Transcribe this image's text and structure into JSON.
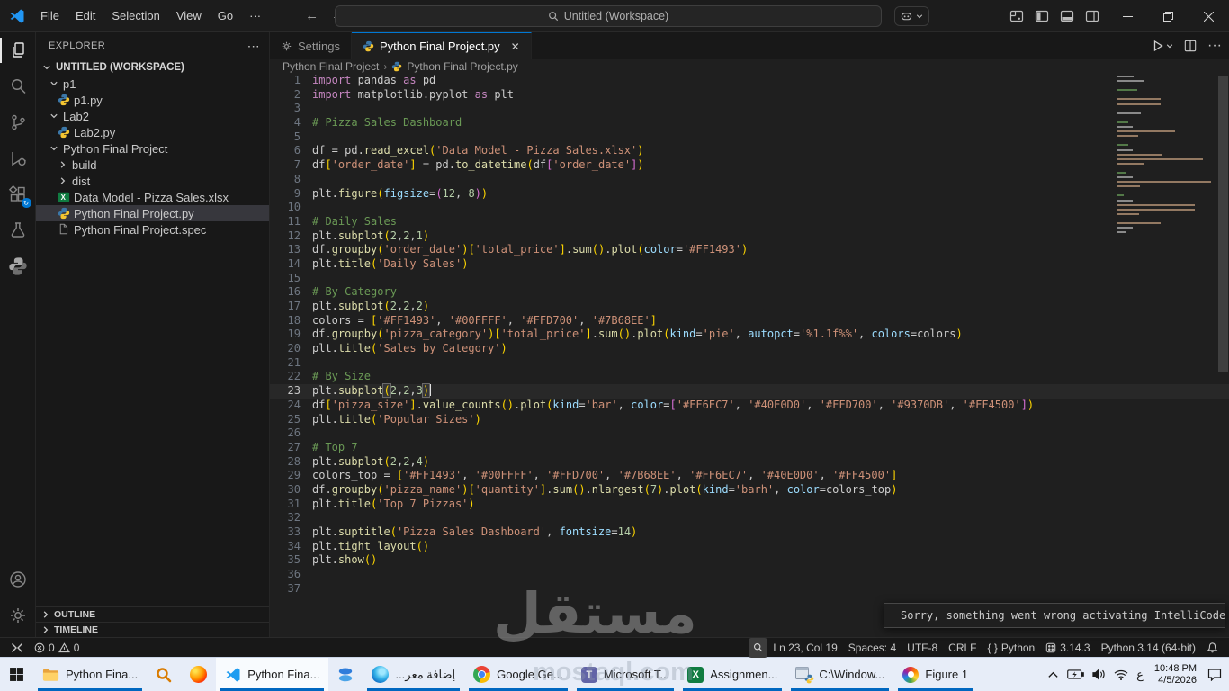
{
  "titlebar": {
    "menus": [
      "File",
      "Edit",
      "Selection",
      "View",
      "Go"
    ],
    "more_label": "···",
    "back": "←",
    "forward": "→",
    "search_text": "Untitled (Workspace)"
  },
  "tabs": {
    "settings": "Settings",
    "main": "Python Final Project.py",
    "close": "✕",
    "more_actions": "···"
  },
  "breadcrumbs": {
    "folder": "Python Final Project",
    "sep": "›",
    "file": "Python Final Project.py"
  },
  "sidebar": {
    "title": "EXPLORER",
    "more": "⋯",
    "tree": [
      {
        "label": "UNTITLED (WORKSPACE)"
      },
      {
        "label": "p1"
      },
      {
        "label": "p1.py"
      },
      {
        "label": "Lab2"
      },
      {
        "label": "Lab2.py"
      },
      {
        "label": "Python Final Project"
      },
      {
        "label": "build"
      },
      {
        "label": "dist"
      },
      {
        "label": "Data Model - Pizza Sales.xlsx"
      },
      {
        "label": "Python Final Project.py"
      },
      {
        "label": "Python Final Project.spec"
      }
    ],
    "panels": {
      "outline": "OUTLINE",
      "timeline": "TIMELINE"
    }
  },
  "editor": {
    "active_line": 23,
    "cursor_col": 19,
    "lines": [
      "import pandas as pd",
      "import matplotlib.pyplot as plt",
      "",
      "# Pizza Sales Dashboard",
      "",
      "df = pd.read_excel('Data Model - Pizza Sales.xlsx')",
      "df['order_date'] = pd.to_datetime(df['order_date'])",
      "",
      "plt.figure(figsize=(12, 8))",
      "",
      "# Daily Sales",
      "plt.subplot(2,2,1)",
      "df.groupby('order_date')['total_price'].sum().plot(color='#FF1493')",
      "plt.title('Daily Sales')",
      "",
      "# By Category",
      "plt.subplot(2,2,2)",
      "colors = ['#FF1493', '#00FFFF', '#FFD700', '#7B68EE']",
      "df.groupby('pizza_category')['total_price'].sum().plot(kind='pie', autopct='%1.1f%%', colors=colors)",
      "plt.title('Sales by Category')",
      "",
      "# By Size",
      "plt.subplot(2,2,3)",
      "df['pizza_size'].value_counts().plot(kind='bar', color=['#FF6EC7', '#40E0D0', '#FFD700', '#9370DB', '#FF4500'])",
      "plt.title('Popular Sizes')",
      "",
      "# Top 7",
      "plt.subplot(2,2,4)",
      "colors_top = ['#FF1493', '#00FFFF', '#FFD700', '#7B68EE', '#FF6EC7', '#40E0D0', '#FF4500']",
      "df.groupby('pizza_name')['quantity'].sum().nlargest(7).plot(kind='barh', color=colors_top)",
      "plt.title('Top 7 Pizzas')",
      "",
      "plt.suptitle('Pizza Sales Dashboard', fontsize=14)",
      "plt.tight_layout()",
      "plt.show()",
      "",
      ""
    ]
  },
  "notification": {
    "message": "Sorry, something went wrong activating IntelliCode support for Pytho..."
  },
  "status_bar": {
    "errors": "0",
    "warnings": "0",
    "line_col": "Ln 23, Col 19",
    "spaces": "Spaces: 4",
    "encoding": "UTF-8",
    "eol": "CRLF",
    "braces": "{ }",
    "language": "Python",
    "version": "3.14.3",
    "interpreter": "Python 3.14 (64-bit)"
  },
  "watermark": {
    "text": "مستقل",
    "domain": "mostaql.com"
  },
  "taskbar": {
    "labels": {
      "explorer": "Python Fina...",
      "vscode": "Python Fina...",
      "edge": "إضافة معر...",
      "chrome": "Google Ge...",
      "teams": "Microsoft T...",
      "excel": "Assignmen...",
      "python_console": "C:\\Window...",
      "figure": "Figure 1"
    },
    "teams_letter": "T",
    "excel_letter": "X",
    "tray": {
      "lang": "ع",
      "time": "10:48 PM",
      "date": "4/5/2026"
    }
  },
  "colors": {
    "accent": "#0078d4",
    "taskbar_underline": "#0067c0",
    "keyword": "#C586C0",
    "string": "#CE9178",
    "comment": "#6A9955",
    "function": "#DCDCAA",
    "number": "#B5CEA8",
    "kwarg": "#9CDCFE",
    "bracket_levels": [
      "#FFD700",
      "#DA70D6",
      "#179FFF"
    ]
  }
}
